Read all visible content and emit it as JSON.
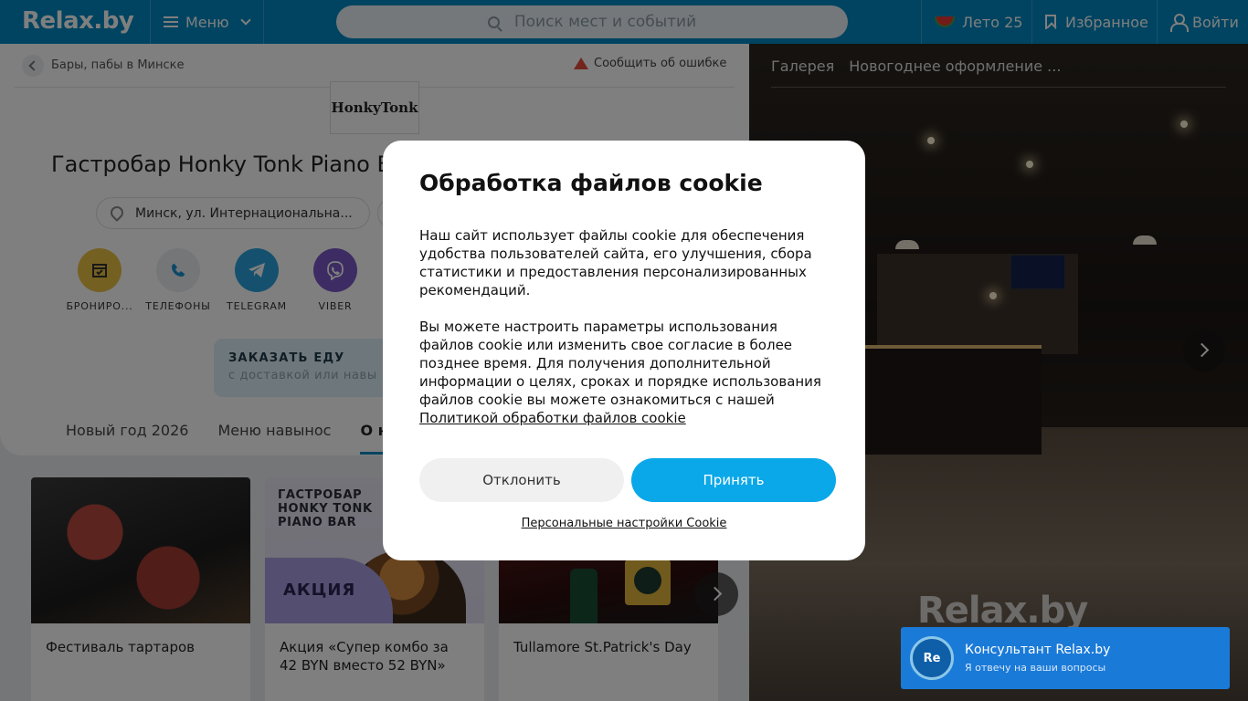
{
  "header": {
    "logo": "Relax.by",
    "menu_label": "Меню",
    "search_placeholder": "Поиск мест и событий",
    "summer_label": "Лето 25",
    "favorites_label": "Избранное",
    "login_label": "Войти"
  },
  "venue": {
    "breadcrumb": "Бары, пабы в Минске",
    "report_label": "Сообщить об ошибке",
    "logo_text": "HonkyTonk",
    "title": "Гастробар Honky Tonk Piano B",
    "address": "Минск, ул. Интернациональна...",
    "actions": [
      {
        "label": "БРОНИРО...",
        "color": "#e8c043"
      },
      {
        "label": "ТЕЛЕФОНЫ",
        "color": "#e9edf0"
      },
      {
        "label": "TELEGRAM",
        "color": "#2aa3dd"
      },
      {
        "label": "VIBER",
        "color": "#7b59c7"
      }
    ],
    "order_title": "ЗАКАЗАТЬ ЕДУ",
    "order_subtitle": "с доставкой или навы",
    "tabs": [
      "Новый год 2026",
      "Меню навынос",
      "О нас"
    ]
  },
  "cards": [
    {
      "title": "Фестиваль тартаров"
    },
    {
      "title": "Акция «Супер комбо за 42 BYN вместо 52 BYN»",
      "caption": "ГАСТРОБАР HONKY TONK PIANO BAR",
      "promo": "АКЦИЯ"
    },
    {
      "title": "Tullamore St.Patrick's Day"
    }
  ],
  "gallery": {
    "tabs": [
      "Галерея",
      "Новогоднее оформление ..."
    ],
    "watermark": "Relax.by"
  },
  "cookie": {
    "title": "Обработка файлов cookie",
    "paragraph1": "Наш сайт использует файлы cookie для обеспечения удобства пользователей сайта, его улучшения, сбора статистики и предоставления персонализированных рекомендаций.",
    "paragraph2": "Вы можете настроить параметры использования файлов cookie или изменить свое согласие в более позднее время. Для получения дополнительной информации о целях, сроках и порядке использования файлов cookie вы можете ознакомиться с нашей ",
    "policy_link": "Политикой обработки файлов cookie",
    "decline_label": "Отклонить",
    "accept_label": "Принять",
    "settings_link": "Персональные настройки Cookie"
  },
  "consultant": {
    "avatar": "Re",
    "name": "Консультант Relax.by",
    "subtitle": "Я отвечу на ваши вопросы"
  }
}
